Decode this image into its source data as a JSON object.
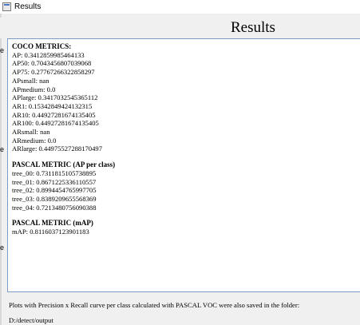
{
  "window": {
    "title": "Results"
  },
  "heading": "Results",
  "side_labels": [
    "e",
    "e",
    "e"
  ],
  "coco": {
    "title": "COCO METRICS:",
    "lines": [
      "AP: 0.3412859985464133",
      "AP50: 0.7043456807039068",
      "AP75: 0.27767266322858297",
      "APsmall: nan",
      "APmedium: 0.0",
      "APlarge: 0.3417032545365112",
      "AR1: 0.15342849424132315",
      "AR10: 0.44927281674135405",
      "AR100: 0.44927281674135405",
      "ARsmall: nan",
      "ARmedium: 0.0",
      "ARlarge: 0.44975527288170497"
    ]
  },
  "pascal_ap": {
    "title": "PASCAL METRIC (AP per class)",
    "lines": [
      "tree_00: 0.7311815105738895",
      "tree_01: 0.8671225336110557",
      "tree_02: 0.8994454765997705",
      "tree_03: 0.8389209655568369",
      "tree_04: 0.7213480756090388"
    ]
  },
  "pascal_map": {
    "title": "PASCAL METRIC (mAP)",
    "lines": [
      "mAP: 0.8116037123901183"
    ]
  },
  "footer": {
    "message": "Plots with Precision x Recall curve per class calculated with PASCAL VOC were also saved in the folder:",
    "path": "D:/detect/output"
  }
}
